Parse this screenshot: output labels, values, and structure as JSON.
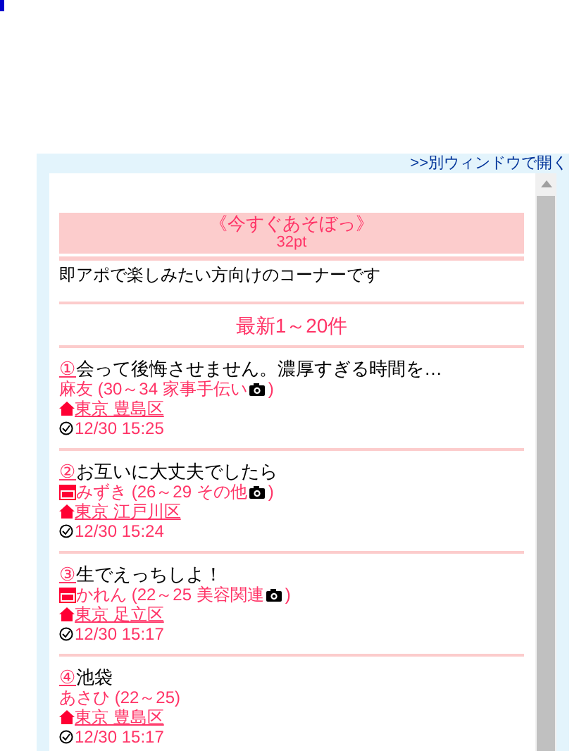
{
  "open_link": ">>別ウィンドウで開く",
  "header": {
    "title": "《今すぐあそぼっ》",
    "points": "32pt"
  },
  "description": "即アポで楽しみたい方向けのコーナーです",
  "section_heading": "最新1～20件",
  "posts": [
    {
      "number": "①",
      "title": "会って後悔させません。濃厚すぎる時間を…",
      "badge": false,
      "meta": "麻友 (30～34 家事手伝い",
      "photo": true,
      "meta_end": ")",
      "location": "東京 豊島区",
      "time": "12/30 15:25"
    },
    {
      "number": "②",
      "title": "お互いに大丈夫でしたら",
      "badge": true,
      "meta": "みずき (26～29 その他",
      "photo": true,
      "meta_end": ")",
      "location": "東京 江戸川区",
      "time": "12/30 15:24"
    },
    {
      "number": "③",
      "title": "生でえっちしよ！",
      "badge": true,
      "meta": "かれん (22～25 美容関連",
      "photo": true,
      "meta_end": ")",
      "location": "東京 足立区",
      "time": "12/30 15:17"
    },
    {
      "number": "④",
      "title": "池袋",
      "badge": false,
      "meta": "あさひ (22～25)",
      "photo": false,
      "location": "東京 豊島区",
      "time": "12/30 15:17"
    }
  ]
}
